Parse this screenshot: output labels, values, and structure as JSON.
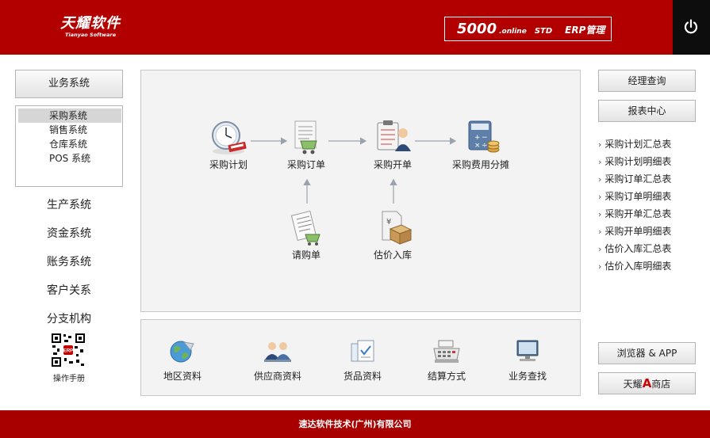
{
  "header": {
    "logo_main": "天耀软件",
    "logo_sub": "Tianyao Software",
    "product_number": "5000",
    "product_online": ".online",
    "product_edition": "STD",
    "product_name": "ERP管理"
  },
  "left": {
    "business_button": "业务系统",
    "sub_items": [
      "采购系统",
      "销售系统",
      "仓库系统",
      "POS 系统"
    ],
    "menu": [
      "生产系统",
      "资金系统",
      "账务系统",
      "客户关系",
      "分支机构"
    ],
    "qr_label": "操作手册"
  },
  "flow": {
    "nodes": {
      "plan": "采购计划",
      "order": "采购订单",
      "invoice": "采购开单",
      "fee": "采购费用分摊",
      "request": "请购单",
      "estimate": "估价入库"
    }
  },
  "base": {
    "items": [
      "地区资料",
      "供应商资料",
      "货品资料",
      "结算方式",
      "业务查找"
    ]
  },
  "right": {
    "manager_query": "经理查询",
    "report_center": "报表中心",
    "links": [
      "采购计划汇总表",
      "采购计划明细表",
      "采购订单汇总表",
      "采购订单明细表",
      "采购开单汇总表",
      "采购开单明细表",
      "估价入库汇总表",
      "估价入库明细表"
    ],
    "browser_app": "浏览器 & APP",
    "store_prefix": "天耀",
    "store_letter": "A",
    "store_suffix": "商店"
  },
  "footer": {
    "company": "速达软件技术(广州)有限公司"
  },
  "colors": {
    "brand_red": "#b20000",
    "power_bg": "#0d0d0d"
  }
}
